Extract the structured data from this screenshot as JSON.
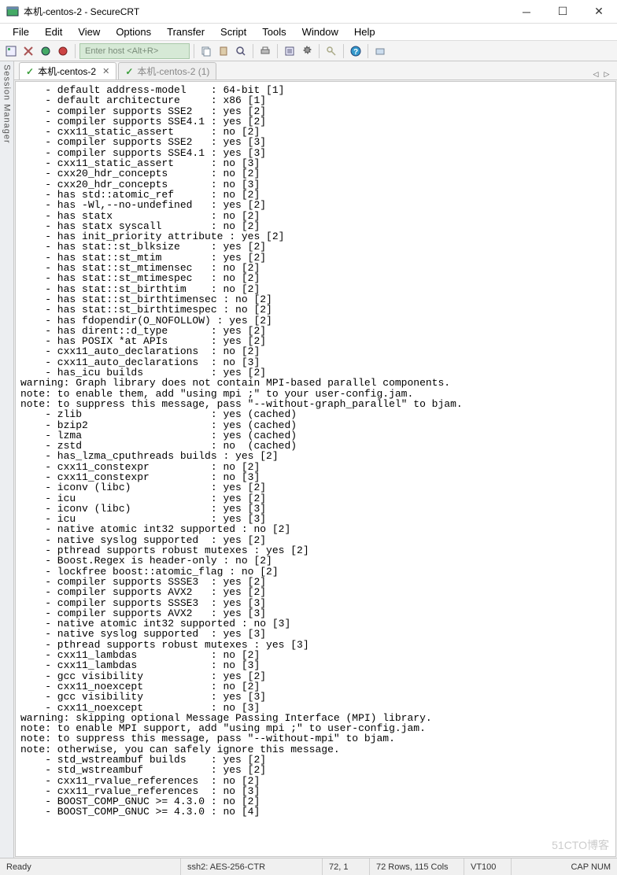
{
  "window": {
    "title": "本机-centos-2 - SecureCRT"
  },
  "menu": [
    "File",
    "Edit",
    "View",
    "Options",
    "Transfer",
    "Script",
    "Tools",
    "Window",
    "Help"
  ],
  "toolbar": {
    "host_placeholder": "Enter host <Alt+R>"
  },
  "tabs": [
    {
      "label": "本机-centos-2",
      "active": true
    },
    {
      "label": "本机-centos-2 (1)",
      "active": false
    }
  ],
  "sidebar": {
    "label": "Session Manager"
  },
  "terminal_lines": [
    "    - default address-model    : 64-bit [1]",
    "    - default architecture     : x86 [1]",
    "    - compiler supports SSE2   : yes [2]",
    "    - compiler supports SSE4.1 : yes [2]",
    "    - cxx11_static_assert      : no [2]",
    "    - compiler supports SSE2   : yes [3]",
    "    - compiler supports SSE4.1 : yes [3]",
    "    - cxx11_static_assert      : no [3]",
    "    - cxx20_hdr_concepts       : no [2]",
    "    - cxx20_hdr_concepts       : no [3]",
    "    - has std::atomic_ref      : no [2]",
    "    - has -Wl,--no-undefined   : yes [2]",
    "    - has statx                : no [2]",
    "    - has statx syscall        : no [2]",
    "    - has init_priority attribute : yes [2]",
    "    - has stat::st_blksize     : yes [2]",
    "    - has stat::st_mtim        : yes [2]",
    "    - has stat::st_mtimensec   : no [2]",
    "    - has stat::st_mtimespec   : no [2]",
    "    - has stat::st_birthtim    : no [2]",
    "    - has stat::st_birthtimensec : no [2]",
    "    - has stat::st_birthtimespec : no [2]",
    "    - has fdopendir(O_NOFOLLOW) : yes [2]",
    "    - has dirent::d_type       : yes [2]",
    "    - has POSIX *at APIs       : yes [2]",
    "    - cxx11_auto_declarations  : no [2]",
    "    - cxx11_auto_declarations  : no [3]",
    "    - has_icu builds           : yes [2]",
    "warning: Graph library does not contain MPI-based parallel components.",
    "note: to enable them, add \"using mpi ;\" to your user-config.jam.",
    "note: to suppress this message, pass \"--without-graph_parallel\" to bjam.",
    "    - zlib                     : yes (cached)",
    "    - bzip2                    : yes (cached)",
    "    - lzma                     : yes (cached)",
    "    - zstd                     : no  (cached)",
    "    - has_lzma_cputhreads builds : yes [2]",
    "    - cxx11_constexpr          : no [2]",
    "    - cxx11_constexpr          : no [3]",
    "    - iconv (libc)             : yes [2]",
    "    - icu                      : yes [2]",
    "    - iconv (libc)             : yes [3]",
    "    - icu                      : yes [3]",
    "    - native atomic int32 supported : no [2]",
    "    - native syslog supported  : yes [2]",
    "    - pthread supports robust mutexes : yes [2]",
    "    - Boost.Regex is header-only : no [2]",
    "    - lockfree boost::atomic_flag : no [2]",
    "    - compiler supports SSSE3  : yes [2]",
    "    - compiler supports AVX2   : yes [2]",
    "    - compiler supports SSSE3  : yes [3]",
    "    - compiler supports AVX2   : yes [3]",
    "    - native atomic int32 supported : no [3]",
    "    - native syslog supported  : yes [3]",
    "    - pthread supports robust mutexes : yes [3]",
    "    - cxx11_lambdas            : no [2]",
    "    - cxx11_lambdas            : no [3]",
    "    - gcc visibility           : yes [2]",
    "    - cxx11_noexcept           : no [2]",
    "    - gcc visibility           : yes [3]",
    "    - cxx11_noexcept           : no [3]",
    "warning: skipping optional Message Passing Interface (MPI) library.",
    "note: to enable MPI support, add \"using mpi ;\" to user-config.jam.",
    "note: to suppress this message, pass \"--without-mpi\" to bjam.",
    "note: otherwise, you can safely ignore this message.",
    "    - std_wstreambuf builds    : yes [2]",
    "    - std_wstreambuf           : yes [2]",
    "    - cxx11_rvalue_references  : no [2]",
    "    - cxx11_rvalue_references  : no [3]",
    "    - BOOST_COMP_GNUC >= 4.3.0 : no [2]",
    "    - BOOST_COMP_GNUC >= 4.3.0 : no [4]"
  ],
  "status": {
    "ready": "Ready",
    "proto": "ssh2: AES-256-CTR",
    "pos": "72,   1",
    "size": "72 Rows, 115 Cols",
    "term": "VT100",
    "caps": "CAP  NUM"
  },
  "watermark": "51CTO博客"
}
